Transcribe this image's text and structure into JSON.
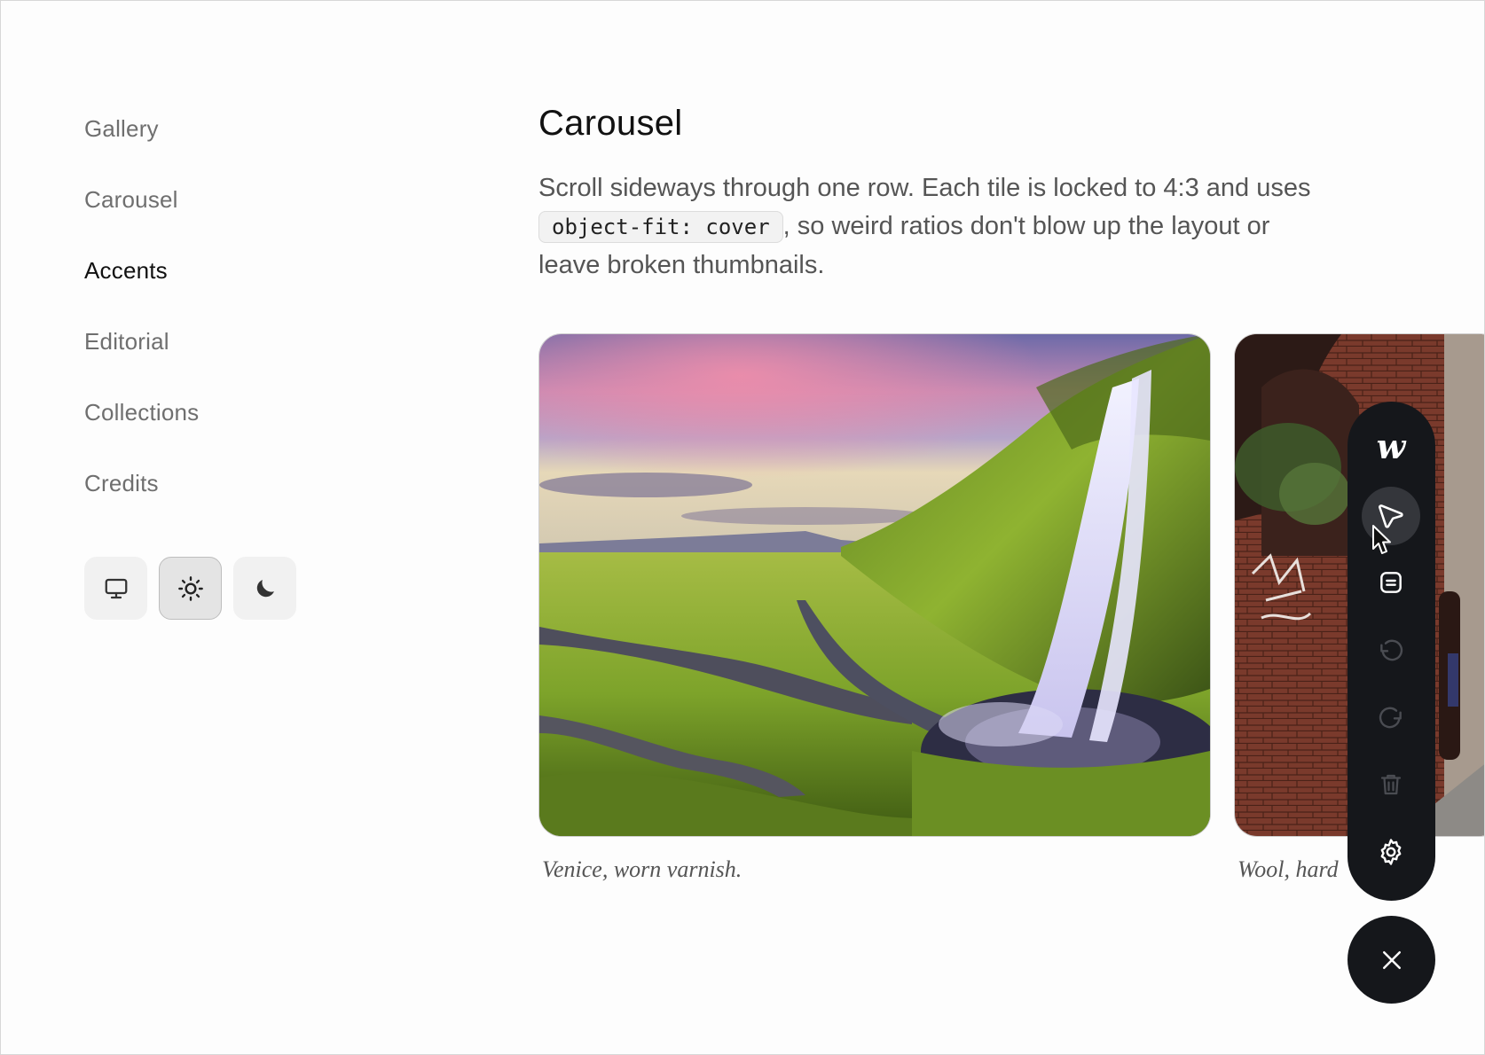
{
  "sidebar": {
    "items": [
      {
        "label": "Gallery"
      },
      {
        "label": "Carousel"
      },
      {
        "label": "Accents"
      },
      {
        "label": "Editorial"
      },
      {
        "label": "Collections"
      },
      {
        "label": "Credits"
      }
    ],
    "active_item": "Accents",
    "theme_options": [
      {
        "icon": "monitor-icon",
        "name": "system"
      },
      {
        "icon": "sun-icon",
        "name": "light",
        "selected": true
      },
      {
        "icon": "moon-icon",
        "name": "dark"
      }
    ]
  },
  "main": {
    "title": "Carousel",
    "intro_before": "Scroll sideways through one row. Each tile is locked to 4:3 and uses ",
    "intro_code": "object-fit: cover",
    "intro_after": ", so weird ratios don't blow up the layout or leave broken thumbnails.",
    "tiles": [
      {
        "caption": "Venice, worn varnish.",
        "image": "waterfall-landscape"
      },
      {
        "caption": "Wool, hard",
        "image": "brick-alley"
      }
    ]
  },
  "toolbar": {
    "logo": "w",
    "items": [
      "logo-icon",
      "comment-pointer-icon",
      "notes-icon",
      "undo-icon",
      "redo-icon",
      "trash-icon",
      "settings-icon"
    ],
    "close": "close-icon"
  },
  "colors": {
    "toolbar_bg": "#15171b",
    "text_muted": "#6f6f6f",
    "text_active": "#111111"
  }
}
